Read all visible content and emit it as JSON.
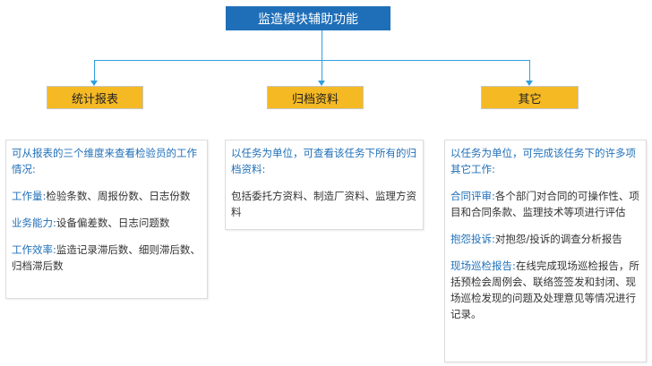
{
  "diagram": {
    "root_title": "监造模块辅助功能",
    "categories": [
      {
        "label": "统计报表"
      },
      {
        "label": "归档资料"
      },
      {
        "label": "其它"
      }
    ],
    "panels": [
      {
        "intro": "可从报表的三个维度来查看检验员的工作情况:",
        "items": [
          {
            "term": "工作量",
            "sep": ":",
            "desc": "检验条数、周报份数、日志份数"
          },
          {
            "term": "业务能力",
            "sep": ":",
            "desc": "设备偏差数、日志问题数"
          },
          {
            "term": "工作效率",
            "sep": ":",
            "desc": "监造记录滞后数、细则滞后数、归档滞后数"
          }
        ]
      },
      {
        "intro": "以任务为单位，可查看该任务下所有的归档资料:",
        "body": "包括委托方资料、制造厂资料、监理方资料"
      },
      {
        "intro": "以任务为单位，可完成该任务下的许多项其它工作:",
        "items": [
          {
            "term": "合同评审",
            "sep": ":",
            "desc": "各个部门对合同的可操作性、项目和合同条款、监理技术等项进行评估"
          },
          {
            "term": "抱怨投诉",
            "sep": ":",
            "desc": "对抱怨/投诉的调查分析报告"
          },
          {
            "term": "现场巡检报告",
            "sep": ":",
            "desc": "在线完成现场巡检报告，所括预检会周例会、联络签签发和封闭、现场巡检发现的问题及处理意见等情况进行记录。"
          }
        ]
      }
    ]
  },
  "colors": {
    "root_fill": "#1f6fb8",
    "category_fill": "#f5b924",
    "connector": "#2e9fe0",
    "highlight_text": "#1f6fb8"
  }
}
